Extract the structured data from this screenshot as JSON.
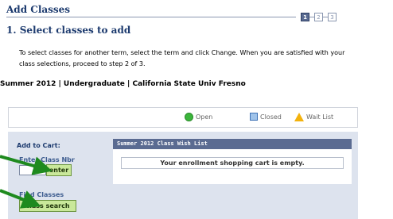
{
  "header": {
    "title": "Add Classes"
  },
  "steps": [
    "1",
    "2",
    "3"
  ],
  "section": {
    "title": "1.  Select classes to add"
  },
  "instructions": "To select classes for another term, select the term and click Change.  When you are satisfied with your class selections, proceed to step 2 of 3.",
  "term": "Summer 2012 | Undergraduate | California State Univ  Fresno",
  "legend": {
    "open": "Open",
    "closed": "Closed",
    "wait": "Wait List"
  },
  "cart": {
    "label": "Add to Cart:",
    "enter_label": "Enter Class Nbr",
    "class_nbr_value": "",
    "enter_button": "enter",
    "find_label": "Find Classes",
    "search_button": "class search"
  },
  "wish_list": {
    "header": "Summer 2012 Class Wish List",
    "empty_message": "Your enrollment shopping cart is empty."
  },
  "colors": {
    "accent": "#5a6b91",
    "title": "#1c3a6e",
    "button": "#c9e89a",
    "arrow": "#1e8a1e"
  }
}
